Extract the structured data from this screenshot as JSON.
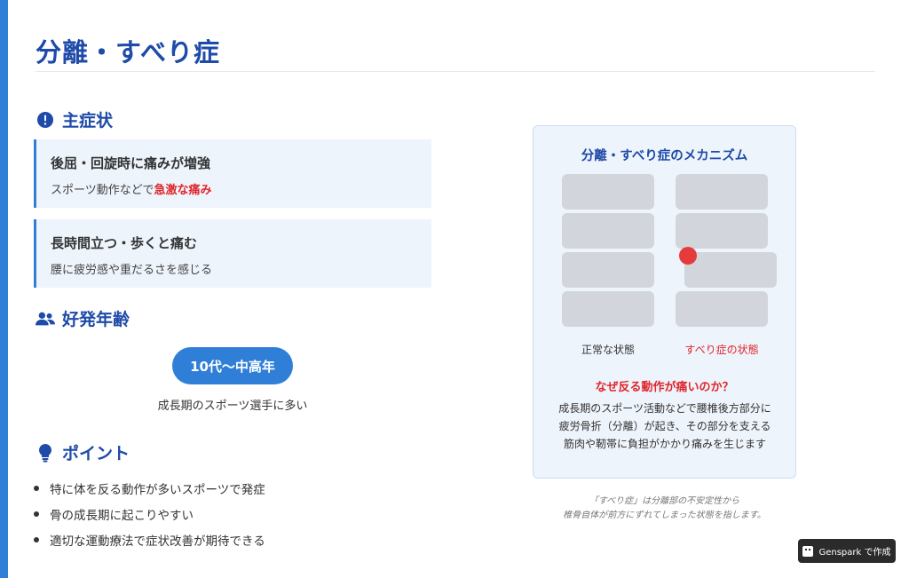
{
  "title": "分離・すべり症",
  "symptoms": {
    "heading": "主症状",
    "cards": [
      {
        "title": "後屈・回旋時に痛みが増強",
        "desc_prefix": "スポーツ動作などで",
        "desc_highlight": "急激な痛み"
      },
      {
        "title": "長時間立つ・歩くと痛む",
        "desc": "腰に疲労感や重だるさを感じる"
      }
    ]
  },
  "age": {
    "heading": "好発年齢",
    "pill": "10代〜中高年",
    "note": "成長期のスポーツ選手に多い"
  },
  "points": {
    "heading": "ポイント",
    "items": [
      "特に体を反る動作が多いスポーツで発症",
      "骨の成長期に起こりやすい",
      "適切な運動療法で症状改善が期待できる"
    ]
  },
  "mechanism": {
    "title": "分離・すべり症のメカニズム",
    "label_normal": "正常な状態",
    "label_slip": "すべり症の状態",
    "why": "なぜ反る動作が痛いのか？",
    "desc_lines": [
      "成長期のスポーツ活動などで腰椎後方部分に",
      "疲労骨折（分離）が起き、その部分を支える",
      "筋肉や靭帯に負担がかかり痛みを生じます"
    ]
  },
  "footnote_lines": [
    "「すべり症」は分離部の不安定性から",
    "椎骨自体が前方にずれてしまった状態を指します。"
  ],
  "badge": "Genspark で作成",
  "colors": {
    "accent": "#2f7fd8",
    "heading": "#1e4aa8",
    "highlight": "#e0262d"
  }
}
